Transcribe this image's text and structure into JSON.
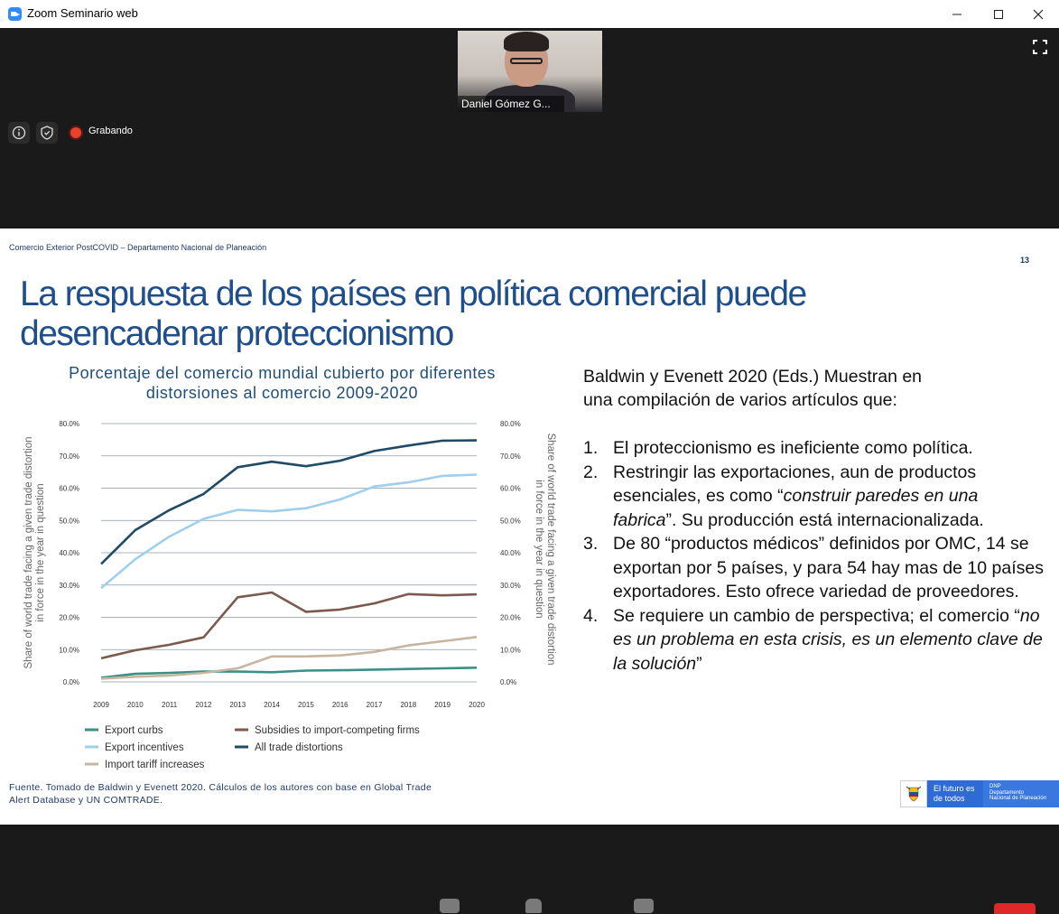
{
  "window": {
    "title": "Zoom Seminario web"
  },
  "meeting": {
    "participant_name": "Daniel Gómez G...",
    "recording_label": "Grabando"
  },
  "slide": {
    "header": "Comercio Exterior PostCOVID – Departamento Nacional de Planeación",
    "number": "13",
    "title_line1": "La respuesta de los países en política comercial puede",
    "title_line2": "desencadenar proteccionismo",
    "chart_title_line1": "Porcentaje del comercio mundial cubierto por diferentes",
    "chart_title_line2": "distorsiones al comercio 2009-2020",
    "source_line1": "Fuente. Tomado de Baldwin y Evenett 2020. Cálculos de los autores con base en Global Trade",
    "source_line2": "Alert Database y UN COMTRADE.",
    "intro_line1": "Baldwin y Evenett 2020 (Eds.) Muestran en",
    "intro_line2": "una compilación de varios artículos que:",
    "points": [
      {
        "num": "1.",
        "text": "El proteccionismo es ineficiente como política."
      },
      {
        "num": "2.",
        "pre": "Restringir las exportaciones, aun de productos esenciales, es como “",
        "em": "construir paredes en una fabrica",
        "post": "”. Su producción está internacionalizada."
      },
      {
        "num": "3.",
        "text": "De 80 “productos médicos” definidos por OMC, 14 se exportan por 5 países, y para 54 hay mas de 10 países exportadores. Esto ofrece variedad de proveedores."
      },
      {
        "num": "4.",
        "pre": "Se requiere un cambio de perspectiva; el comercio “",
        "em": "no es un problema en esta crisis, es un elemento clave de la solución",
        "post": "”"
      }
    ],
    "logo": {
      "futuro": "El futuro es de todos",
      "dnp_line1": "DNP",
      "dnp_line2": "Departamento",
      "dnp_line3": "Nacional de Planeación"
    }
  },
  "colors": {
    "title_blue": "#1f4e8c",
    "recording_red": "#e8412c",
    "end_red": "#e02828"
  },
  "chart_data": {
    "type": "line",
    "x": [
      2009,
      2010,
      2011,
      2012,
      2013,
      2014,
      2015,
      2016,
      2017,
      2018,
      2019,
      2020
    ],
    "ylim": [
      0,
      80
    ],
    "yticks": [
      "0.0%",
      "10.0%",
      "20.0%",
      "30.0%",
      "40.0%",
      "50.0%",
      "60.0%",
      "70.0%",
      "80.0%"
    ],
    "ylabel_left": "Share of world trade facing a given trade distortion in force in the year in question",
    "ylabel_right": "Share of world trade facing a given trade distortion in force in the year in question",
    "grid": true,
    "legend_position": "bottom",
    "series": [
      {
        "name": "Export curbs",
        "color": "#3a8f86",
        "values": [
          1.3,
          2.5,
          2.8,
          3.2,
          3.2,
          3.0,
          3.5,
          3.6,
          3.8,
          4.0,
          4.2,
          4.4
        ]
      },
      {
        "name": "Subsidies to import-competing firms",
        "color": "#7b5a4e",
        "values": [
          7.3,
          9.8,
          11.5,
          13.8,
          26.2,
          27.7,
          21.7,
          22.4,
          24.3,
          27.2,
          26.8,
          27.1
        ]
      },
      {
        "name": "Export incentives",
        "color": "#9fcfea",
        "values": [
          29.0,
          38.0,
          45.0,
          50.5,
          53.3,
          52.8,
          53.8,
          56.5,
          60.5,
          61.8,
          63.8,
          64.2
        ]
      },
      {
        "name": "All trade distortions",
        "color": "#1f4a66",
        "values": [
          36.5,
          47.0,
          53.2,
          58.2,
          66.5,
          68.2,
          66.8,
          68.5,
          71.5,
          73.2,
          74.7,
          74.8
        ]
      },
      {
        "name": "Import tariff increases",
        "color": "#c8b5a0",
        "values": [
          1.0,
          1.6,
          2.0,
          2.8,
          4.2,
          7.9,
          7.9,
          8.2,
          9.3,
          11.3,
          12.6,
          13.9
        ]
      }
    ]
  }
}
